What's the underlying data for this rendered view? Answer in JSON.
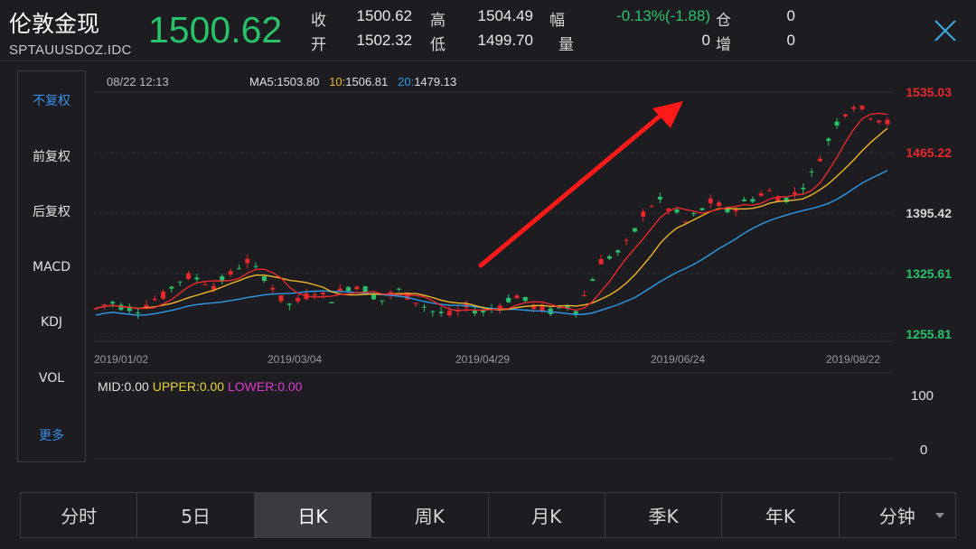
{
  "header": {
    "title": "伦敦金现",
    "code": "SPTAUUSDOZ.IDC",
    "price": "1500.62",
    "close_label": "收",
    "close_value": "1500.62",
    "open_label": "开",
    "open_value": "1502.32",
    "high_label": "高",
    "high_value": "1504.49",
    "low_label": "低",
    "low_value": "1499.70",
    "range_label": "幅",
    "range_value": "-0.13%(-1.88)",
    "volume_label": "量",
    "volume_value": "0",
    "position_label": "仓",
    "position_value": "0",
    "increase_label": "增",
    "increase_value": "0",
    "close_icon": "close-x-icon"
  },
  "left_menu": {
    "items": [
      "不复权",
      "前复权",
      "后复权",
      "MACD",
      "KDJ",
      "VOL",
      "更多"
    ],
    "active_index": 0
  },
  "chart_info": {
    "datetime": "08/22 12:13",
    "ma5_label": "MA5:",
    "ma5_value": "1503.80",
    "ma10_label": "10:",
    "ma10_value": "1506.81",
    "ma20_label": "20:",
    "ma20_value": "1479.13"
  },
  "indicator": {
    "mid": "MID:0.00",
    "upper": "UPPER:0.00",
    "lower": "LOWER:0.00",
    "ymax": "100",
    "ymin": "0"
  },
  "tabs": {
    "items": [
      "分时",
      "5日",
      "日K",
      "周K",
      "月K",
      "季K",
      "年K",
      "分钟"
    ],
    "active_index": 2
  },
  "colors": {
    "up": "#e8282d",
    "down": "#29c26b",
    "ma5": "#e8282d",
    "ma10": "#f0b429",
    "ma20": "#2d9ae8",
    "accent": "#3a8ee6",
    "annotation_arrow": "#ff1a1a"
  },
  "chart_data": {
    "type": "candlestick",
    "y_axis_labels": [
      "1535.03",
      "1465.22",
      "1395.42",
      "1325.61",
      "1255.81"
    ],
    "ylim": [
      1255.81,
      1535.03
    ],
    "x_tick_labels": [
      "2019/01/02",
      "2019/03/04",
      "2019/04/29",
      "2019/06/24",
      "2019/08/22"
    ],
    "series": [
      {
        "name": "MA5",
        "value": 1503.8
      },
      {
        "name": "MA10",
        "value": 1506.81
      },
      {
        "name": "MA20",
        "value": 1479.13
      }
    ],
    "close_path": [
      1285,
      1290,
      1292,
      1288,
      1286,
      1284,
      1290,
      1296,
      1300,
      1310,
      1318,
      1322,
      1320,
      1316,
      1312,
      1318,
      1325,
      1334,
      1340,
      1330,
      1322,
      1310,
      1296,
      1290,
      1294,
      1300,
      1305,
      1300,
      1296,
      1305,
      1310,
      1312,
      1308,
      1300,
      1295,
      1302,
      1306,
      1300,
      1294,
      1288,
      1282,
      1280,
      1278,
      1282,
      1286,
      1284,
      1282,
      1285,
      1290,
      1296,
      1300,
      1294,
      1288,
      1284,
      1282,
      1285,
      1288,
      1284,
      1300,
      1320,
      1340,
      1345,
      1350,
      1360,
      1375,
      1395,
      1405,
      1410,
      1400,
      1395,
      1385,
      1392,
      1400,
      1408,
      1404,
      1398,
      1402,
      1408,
      1412,
      1418,
      1420,
      1414,
      1412,
      1418,
      1428,
      1440,
      1460,
      1480,
      1500,
      1512,
      1520,
      1515,
      1508,
      1504,
      1500
    ],
    "up_color": "#e8282d",
    "down_color": "#29c26b",
    "annotation": "arrow-up-right"
  }
}
